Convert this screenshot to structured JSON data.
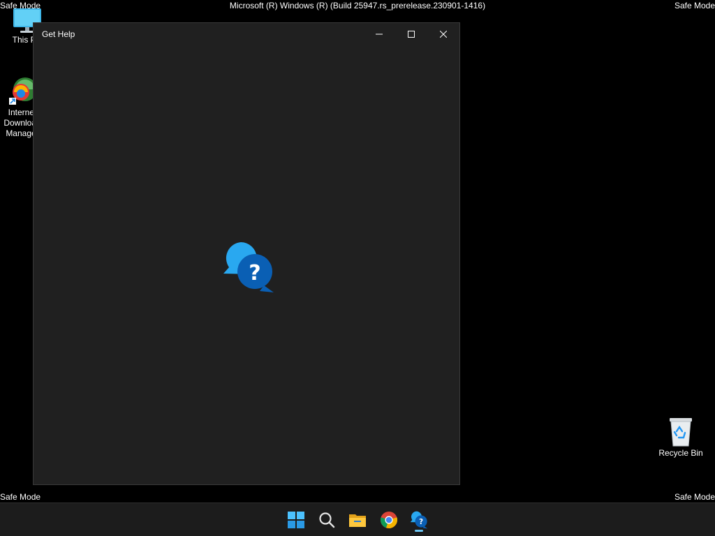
{
  "watermark": {
    "top_left": "Safe Mode",
    "top_center": "Microsoft (R) Windows (R) (Build 25947.rs_prerelease.230901-1416)",
    "top_right": "Safe Mode",
    "bottom_left": "Safe Mode",
    "bottom_right": "Safe Mode"
  },
  "desktop": {
    "icons": [
      {
        "label": "This PC",
        "icon": "monitor-icon"
      },
      {
        "label": "Internet Download Manager",
        "icon": "idm-icon"
      },
      {
        "label": "Recycle Bin",
        "icon": "recycle-bin-icon"
      }
    ]
  },
  "window": {
    "title": "Get Help",
    "controls": [
      "minimize",
      "maximize",
      "close"
    ],
    "splash_icon": "get-help-icon"
  },
  "taskbar": {
    "items": [
      {
        "name": "Start",
        "icon": "windows-start-icon"
      },
      {
        "name": "Search",
        "icon": "search-icon"
      },
      {
        "name": "File Explorer",
        "icon": "folder-icon"
      },
      {
        "name": "Google Chrome",
        "icon": "chrome-icon"
      },
      {
        "name": "Get Help",
        "icon": "get-help-icon",
        "active": true
      }
    ]
  },
  "colors": {
    "desktop_bg": "#000000",
    "window_bg": "#202020",
    "taskbar_bg": "#1c1c1c",
    "accent": "#0f6cbd"
  }
}
